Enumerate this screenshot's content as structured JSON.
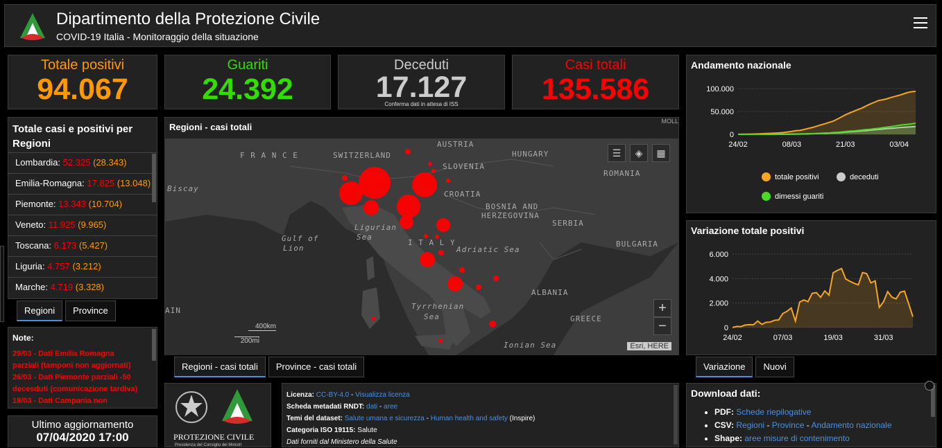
{
  "header": {
    "title": "Dipartimento della Protezione Civile",
    "subtitle": "COVID-19 Italia - Monitoraggio della situazione"
  },
  "kpis": {
    "totale_positivi": {
      "label": "Totale positivi",
      "value": "94.067",
      "color": "#ff9900"
    },
    "guariti": {
      "label": "Guariti",
      "value": "24.392",
      "color": "#33dd00"
    },
    "deceduti": {
      "label": "Deceduti",
      "value": "17.127",
      "note": "Conferma dati in attesa di ISS",
      "color": "#cccccc"
    },
    "casi_totali": {
      "label": "Casi totali",
      "value": "135.586",
      "color": "#ff0000"
    }
  },
  "regions_panel": {
    "title": "Totale casi e positivi per Regioni",
    "rows": [
      {
        "name": "Lombardia:",
        "total": "52.325",
        "positive": "28.343"
      },
      {
        "name": "Emilia-Romagna:",
        "total": "17.825",
        "positive": "13.048"
      },
      {
        "name": "Piemonte:",
        "total": "13.343",
        "positive": "10.704"
      },
      {
        "name": "Veneto:",
        "total": "11.925",
        "positive": "9.965"
      },
      {
        "name": "Toscana:",
        "total": "6.173",
        "positive": "5.427"
      },
      {
        "name": "Liguria:",
        "total": "4.757",
        "positive": "3.212"
      },
      {
        "name": "Marche:",
        "total": "4.719",
        "positive": "3.328"
      }
    ],
    "tabs": [
      "Regioni",
      "Province"
    ]
  },
  "notes": {
    "title": "Note:",
    "lines": [
      "29/03 - Dati  Emilia Romagna",
      "parziali (tamponi non aggiornati)",
      "26/03 - Dati Piemonte parziali -50",
      "decesduti (comunicazione tardiva)",
      "18/03 - Dati Campania non"
    ]
  },
  "update": {
    "label": "Ultimo aggiornamento",
    "value": "07/04/2020 17:00"
  },
  "map": {
    "title": "Regioni - casi totali",
    "labels": {
      "france": "F R A N C E",
      "switzerland": "SWITZERLAND",
      "austria": "AUSTRIA",
      "hungary": "HUNGARY",
      "slovenia": "SLOVENIA",
      "croatia": "CROATIA",
      "romania": "ROMANIA",
      "bosnia": "BOSNIA AND",
      "herzegovina": "HERZEGOVINA",
      "serbia": "SERBIA",
      "bulgaria": "BULGARIA",
      "italy": "I T A L Y",
      "adriatic": "Adriatic Sea",
      "ligurian1": "Ligurian",
      "ligurian2": "Sea",
      "gulf1": "Gulf of",
      "gulf2": "Lion",
      "biscay": "Biscay",
      "tyrrhenian1": "Tyrrhenian",
      "tyrrhenian2": "Sea",
      "albania": "ALBANIA",
      "greece": "GREECE",
      "ionian": "Ionian Sea",
      "spain": "AIN",
      "moll": "MOLL"
    },
    "scale_km": "400km",
    "scale_mi": "200mi",
    "attribution": "Esri, HERE",
    "zoom_in": "+",
    "zoom_out": "−",
    "tabs": [
      "Regioni - casi totali",
      "Province - casi totali"
    ]
  },
  "chart_national": {
    "title": "Andamento nazionale",
    "legend": [
      "totale positivi",
      "deceduti",
      "dimessi guariti"
    ],
    "colors": [
      "#f5a623",
      "#cccccc",
      "#4cd924"
    ]
  },
  "chart_variation": {
    "title": "Variazione totale positivi",
    "tabs": [
      "Variazione",
      "Nuovi"
    ]
  },
  "chart_data": [
    {
      "type": "line",
      "x": [
        "24/02",
        "25/02",
        "26/02",
        "27/02",
        "28/02",
        "29/02",
        "01/03",
        "02/03",
        "03/03",
        "04/03",
        "05/03",
        "06/03",
        "07/03",
        "08/03",
        "09/03",
        "10/03",
        "11/03",
        "12/03",
        "13/03",
        "14/03",
        "15/03",
        "16/03",
        "17/03",
        "18/03",
        "19/03",
        "20/03",
        "21/03",
        "22/03",
        "23/03",
        "24/03",
        "25/03",
        "26/03",
        "27/03",
        "28/03",
        "29/03",
        "30/03",
        "31/03",
        "01/04",
        "02/04",
        "03/04",
        "04/04",
        "05/04",
        "06/04",
        "07/04"
      ],
      "xticks": [
        "24/02",
        "08/03",
        "21/03",
        "03/04"
      ],
      "yticks": [
        "100.000",
        "50.000",
        "0"
      ],
      "ylim": [
        0,
        100000
      ],
      "series": [
        {
          "name": "totale positivi",
          "values": [
            221,
            311,
            385,
            588,
            821,
            1049,
            1577,
            1835,
            2263,
            2706,
            3296,
            3916,
            5061,
            6387,
            7985,
            8514,
            10590,
            12839,
            14955,
            17750,
            20603,
            23073,
            26062,
            28710,
            33190,
            37860,
            42681,
            46638,
            50418,
            54030,
            57521,
            62013,
            66414,
            70065,
            73880,
            75528,
            77635,
            80572,
            83049,
            85388,
            88274,
            91246,
            93187,
            94067
          ]
        },
        {
          "name": "deceduti",
          "values": [
            7,
            10,
            12,
            17,
            21,
            29,
            34,
            52,
            79,
            107,
            148,
            197,
            233,
            366,
            463,
            631,
            827,
            1016,
            1266,
            1441,
            1809,
            2158,
            2503,
            2978,
            3405,
            4032,
            4825,
            5476,
            6077,
            6820,
            7503,
            8165,
            9134,
            10023,
            10779,
            11591,
            12428,
            13155,
            13915,
            14681,
            15362,
            15887,
            16523,
            17127
          ]
        },
        {
          "name": "dimessi guariti",
          "values": [
            1,
            1,
            3,
            45,
            46,
            50,
            83,
            149,
            160,
            276,
            414,
            523,
            589,
            622,
            724,
            1004,
            1045,
            1258,
            1439,
            1966,
            2335,
            2749,
            2941,
            4025,
            4440,
            5129,
            6072,
            7024,
            7432,
            8326,
            9362,
            10361,
            10950,
            12384,
            13030,
            14620,
            15729,
            16847,
            18278,
            19758,
            20996,
            21815,
            22837,
            24392
          ]
        }
      ]
    },
    {
      "type": "area",
      "x": [
        "24/02",
        "25/02",
        "26/02",
        "27/02",
        "28/02",
        "29/02",
        "01/03",
        "02/03",
        "03/03",
        "04/03",
        "05/03",
        "06/03",
        "07/03",
        "08/03",
        "09/03",
        "10/03",
        "11/03",
        "12/03",
        "13/03",
        "14/03",
        "15/03",
        "16/03",
        "17/03",
        "18/03",
        "19/03",
        "20/03",
        "21/03",
        "22/03",
        "23/03",
        "24/03",
        "25/03",
        "26/03",
        "27/03",
        "28/03",
        "29/03",
        "30/03",
        "31/03",
        "01/04",
        "02/04",
        "03/04",
        "04/04",
        "05/04",
        "06/04",
        "07/04"
      ],
      "xticks": [
        "24/02",
        "07/03",
        "19/03",
        "31/03"
      ],
      "yticks": [
        "6.000",
        "4.000",
        "2.000",
        "0"
      ],
      "ylim": [
        0,
        6000
      ],
      "series": [
        {
          "name": "variazione",
          "values": [
            0,
            90,
            74,
            203,
            233,
            228,
            528,
            258,
            428,
            443,
            590,
            620,
            1145,
            1326,
            1598,
            529,
            2076,
            2249,
            2116,
            2795,
            2853,
            2470,
            2989,
            2648,
            4480,
            4670,
            4821,
            3957,
            3780,
            3612,
            3491,
            4492,
            4401,
            3651,
            3815,
            1648,
            2107,
            2937,
            2477,
            2339,
            2886,
            2972,
            1941,
            880
          ]
        }
      ]
    }
  ],
  "license": {
    "l1_key": "Licenza:",
    "l1_a": "CC-BY-4.0",
    "l1_sep": " - ",
    "l1_b": "Visualizza licenza",
    "l2_key": "Scheda metadati RNDT:",
    "l2_a": "dati",
    "l2_sep": " - ",
    "l2_b": "aree",
    "l3_key": "Temi del dataset:",
    "l3_a": "Salute umana e sicurezza",
    "l3_sep": " - ",
    "l3_b": "Human health and safety",
    "l3_c": " (Inspire)",
    "l4_key": "Categoria ISO 19115:",
    "l4_v": " Salute",
    "l5": "Dati forniti dal Ministero della Salute"
  },
  "logos": {
    "name": "PROTEZIONE CIVILE",
    "sub": "Presidenza del Consiglio dei Ministri"
  },
  "download": {
    "title": "Download dati:",
    "pdf_key": "PDF:",
    "pdf_a": "Schede riepilogative",
    "csv_key": "CSV:",
    "csv_a": "Regioni",
    "csv_b": "Province",
    "csv_c": "Andamento nazionale",
    "sep": " - ",
    "shape_key": "Shape:",
    "shape_a": "aree misure di contenimento"
  }
}
